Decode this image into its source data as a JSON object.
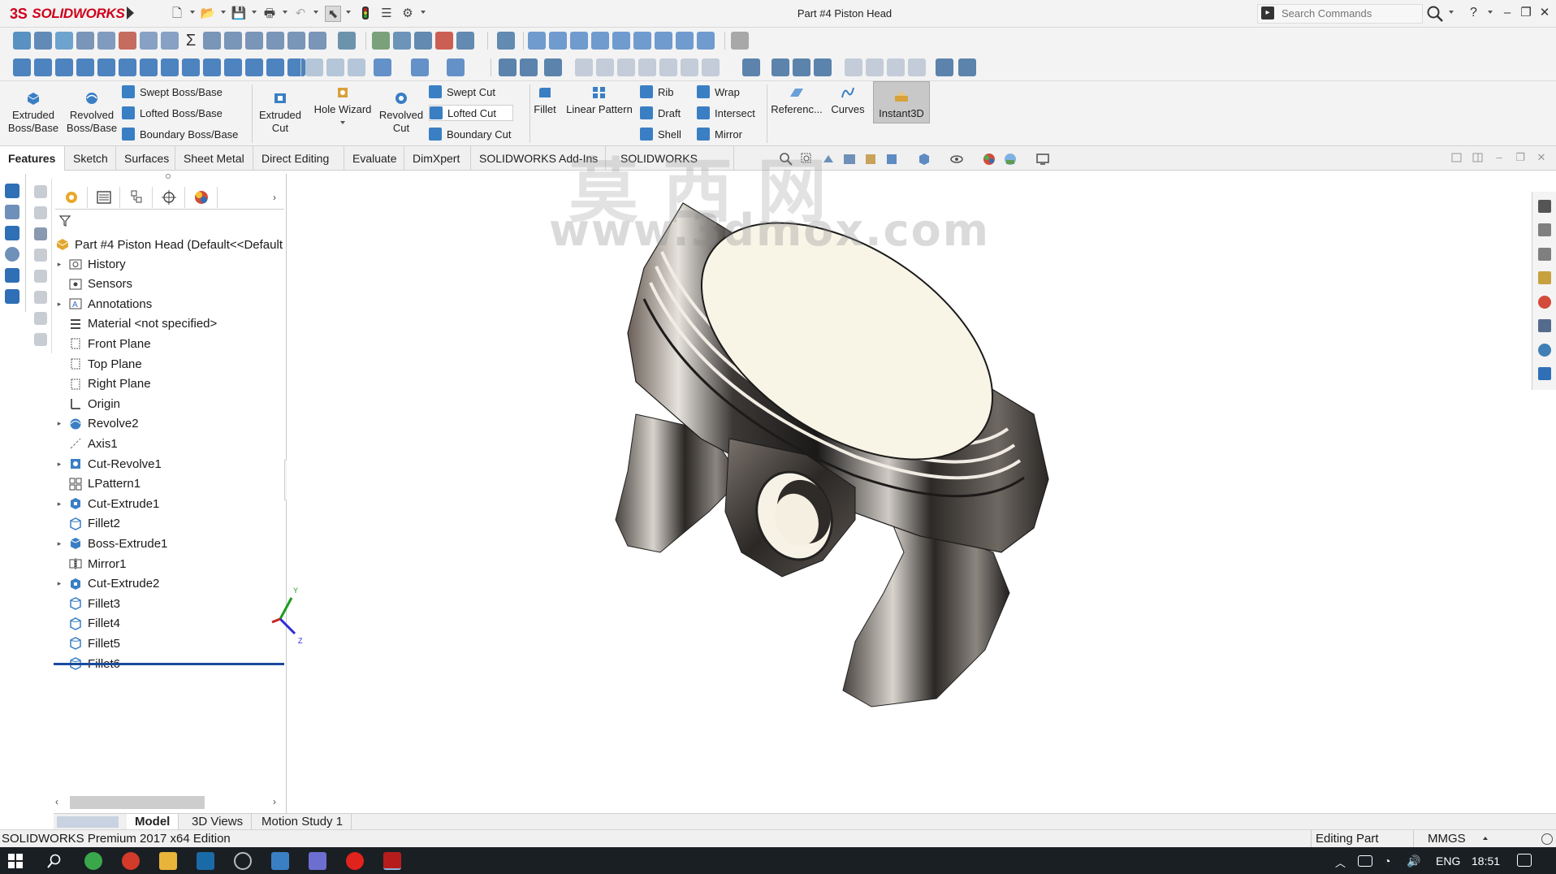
{
  "app": {
    "brand": "SOLIDWORKS",
    "doc_title": "Part #4 Piston Head"
  },
  "search": {
    "placeholder": "Search Commands"
  },
  "help": {
    "label": "?"
  },
  "command_manager": {
    "extruded_boss": "Extruded\nBoss/Base",
    "revolved_boss": "Revolved\nBoss/Base",
    "swept_boss": "Swept Boss/Base",
    "lofted_boss": "Lofted Boss/Base",
    "boundary_boss": "Boundary Boss/Base",
    "extruded_cut": "Extruded\nCut",
    "hole_wizard": "Hole Wizard",
    "revolved_cut": "Revolved\nCut",
    "swept_cut": "Swept Cut",
    "lofted_cut": "Lofted Cut",
    "boundary_cut": "Boundary Cut",
    "fillet": "Fillet",
    "linear_pattern": "Linear Pattern",
    "rib": "Rib",
    "draft": "Draft",
    "shell": "Shell",
    "wrap": "Wrap",
    "intersect": "Intersect",
    "mirror": "Mirror",
    "reference": "Referenc...",
    "curves": "Curves",
    "instant3d": "Instant3D"
  },
  "tabs": [
    "Features",
    "Sketch",
    "Surfaces",
    "Sheet Metal",
    "Direct Editing",
    "Evaluate",
    "DimXpert",
    "SOLIDWORKS Add-Ins",
    "SOLIDWORKS MBD"
  ],
  "active_tab": "Features",
  "tree": {
    "root": "Part #4 Piston Head  (Default<<Default",
    "nodes": [
      {
        "label": "History",
        "expandable": true,
        "icon": "history-folder-icon"
      },
      {
        "label": "Sensors",
        "expandable": false,
        "icon": "sensors-icon"
      },
      {
        "label": "Annotations",
        "expandable": true,
        "icon": "annotations-icon"
      },
      {
        "label": "Material <not specified>",
        "expandable": false,
        "icon": "material-icon"
      },
      {
        "label": "Front Plane",
        "expandable": false,
        "icon": "plane-icon"
      },
      {
        "label": "Top Plane",
        "expandable": false,
        "icon": "plane-icon"
      },
      {
        "label": "Right Plane",
        "expandable": false,
        "icon": "plane-icon"
      },
      {
        "label": "Origin",
        "expandable": false,
        "icon": "origin-icon"
      },
      {
        "label": "Revolve2",
        "expandable": true,
        "icon": "revolve-feature-icon"
      },
      {
        "label": "Axis1",
        "expandable": false,
        "icon": "axis-icon"
      },
      {
        "label": "Cut-Revolve1",
        "expandable": true,
        "icon": "cut-revolve-feature-icon"
      },
      {
        "label": "LPattern1",
        "expandable": false,
        "icon": "linear-pattern-feature-icon"
      },
      {
        "label": "Cut-Extrude1",
        "expandable": true,
        "icon": "cut-extrude-feature-icon"
      },
      {
        "label": "Fillet2",
        "expandable": false,
        "icon": "fillet-feature-icon"
      },
      {
        "label": "Boss-Extrude1",
        "expandable": true,
        "icon": "boss-extrude-feature-icon"
      },
      {
        "label": "Mirror1",
        "expandable": false,
        "icon": "mirror-feature-icon"
      },
      {
        "label": "Cut-Extrude2",
        "expandable": true,
        "icon": "cut-extrude-feature-icon"
      },
      {
        "label": "Fillet3",
        "expandable": false,
        "icon": "fillet-feature-icon"
      },
      {
        "label": "Fillet4",
        "expandable": false,
        "icon": "fillet-feature-icon"
      },
      {
        "label": "Fillet5",
        "expandable": false,
        "icon": "fillet-feature-icon"
      },
      {
        "label": "Fillet6",
        "expandable": false,
        "icon": "fillet-feature-icon"
      }
    ]
  },
  "model_tabs": [
    "Model",
    "3D Views",
    "Motion Study 1"
  ],
  "active_model_tab": "Model",
  "triad": {
    "y": "Y",
    "z": "Z"
  },
  "status": {
    "edition": "SOLIDWORKS Premium 2017 x64 Edition",
    "mode": "Editing Part",
    "units": "MMGS"
  },
  "taskbar": {
    "language": "ENG",
    "time": "18:51"
  },
  "watermark": {
    "chars": "莫西网",
    "url": "www.3dmox.com"
  },
  "colors": {
    "accent_blue": "#1a4a9c",
    "brand_red": "#d0021b",
    "taskbar": "#1a1f24"
  }
}
